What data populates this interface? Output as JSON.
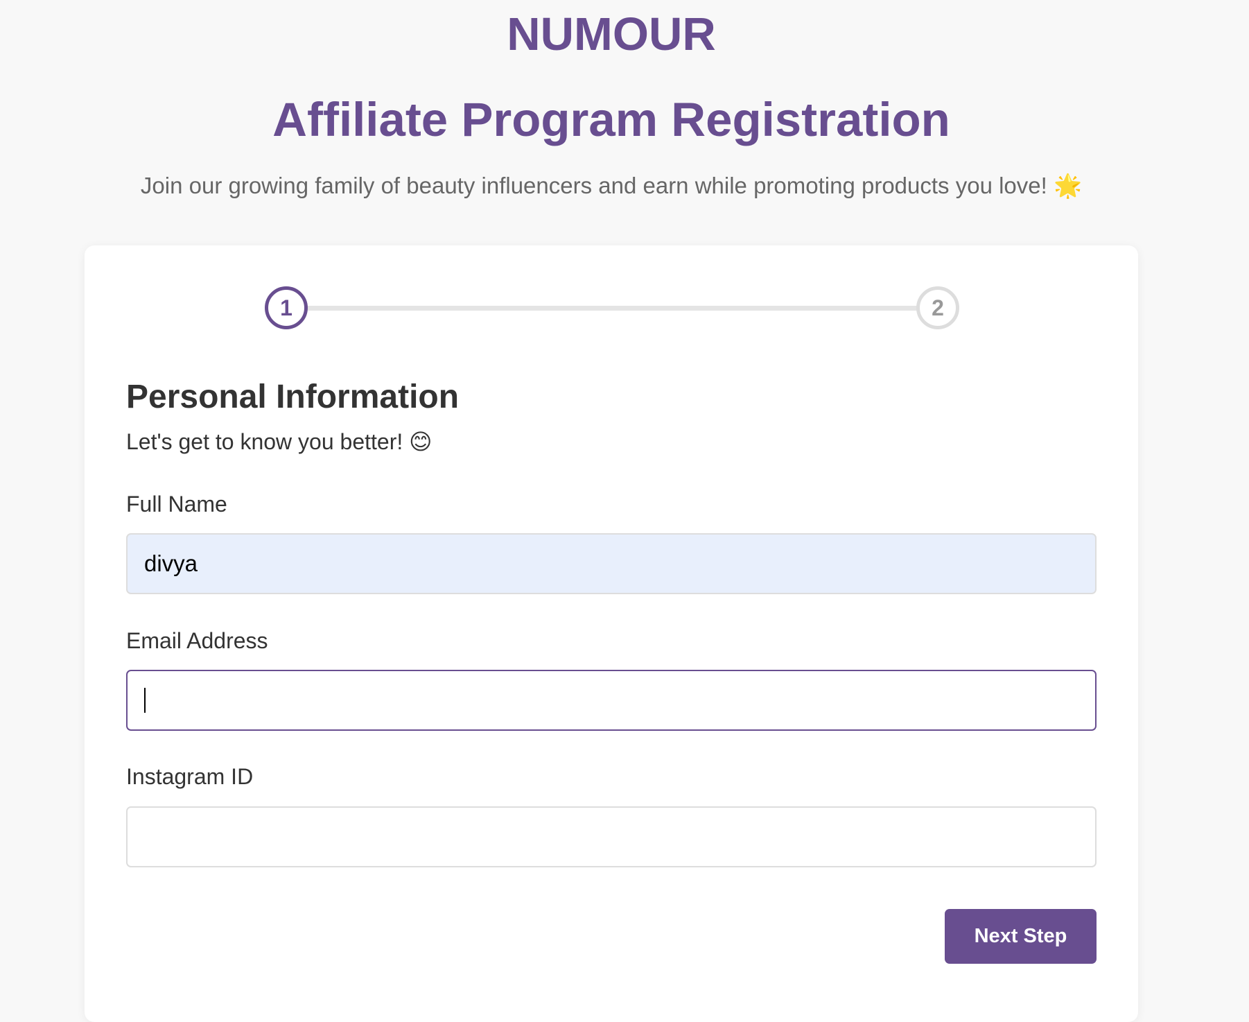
{
  "header": {
    "brand": "NUMOUR",
    "title": "Affiliate Program Registration",
    "subtitle": "Join our growing family of beauty influencers and earn while promoting products you love! 🌟"
  },
  "steps": {
    "step1": "1",
    "step2": "2",
    "current": 1,
    "total": 2
  },
  "section": {
    "heading": "Personal Information",
    "subheading": "Let's get to know you better! 😊"
  },
  "form": {
    "full_name": {
      "label": "Full Name",
      "value": "divya"
    },
    "email": {
      "label": "Email Address",
      "value": ""
    },
    "instagram": {
      "label": "Instagram ID",
      "value": ""
    }
  },
  "actions": {
    "next_label": "Next Step"
  },
  "colors": {
    "accent": "#684e90",
    "autofill_bg": "#e8effc",
    "page_bg": "#f8f8f8"
  }
}
